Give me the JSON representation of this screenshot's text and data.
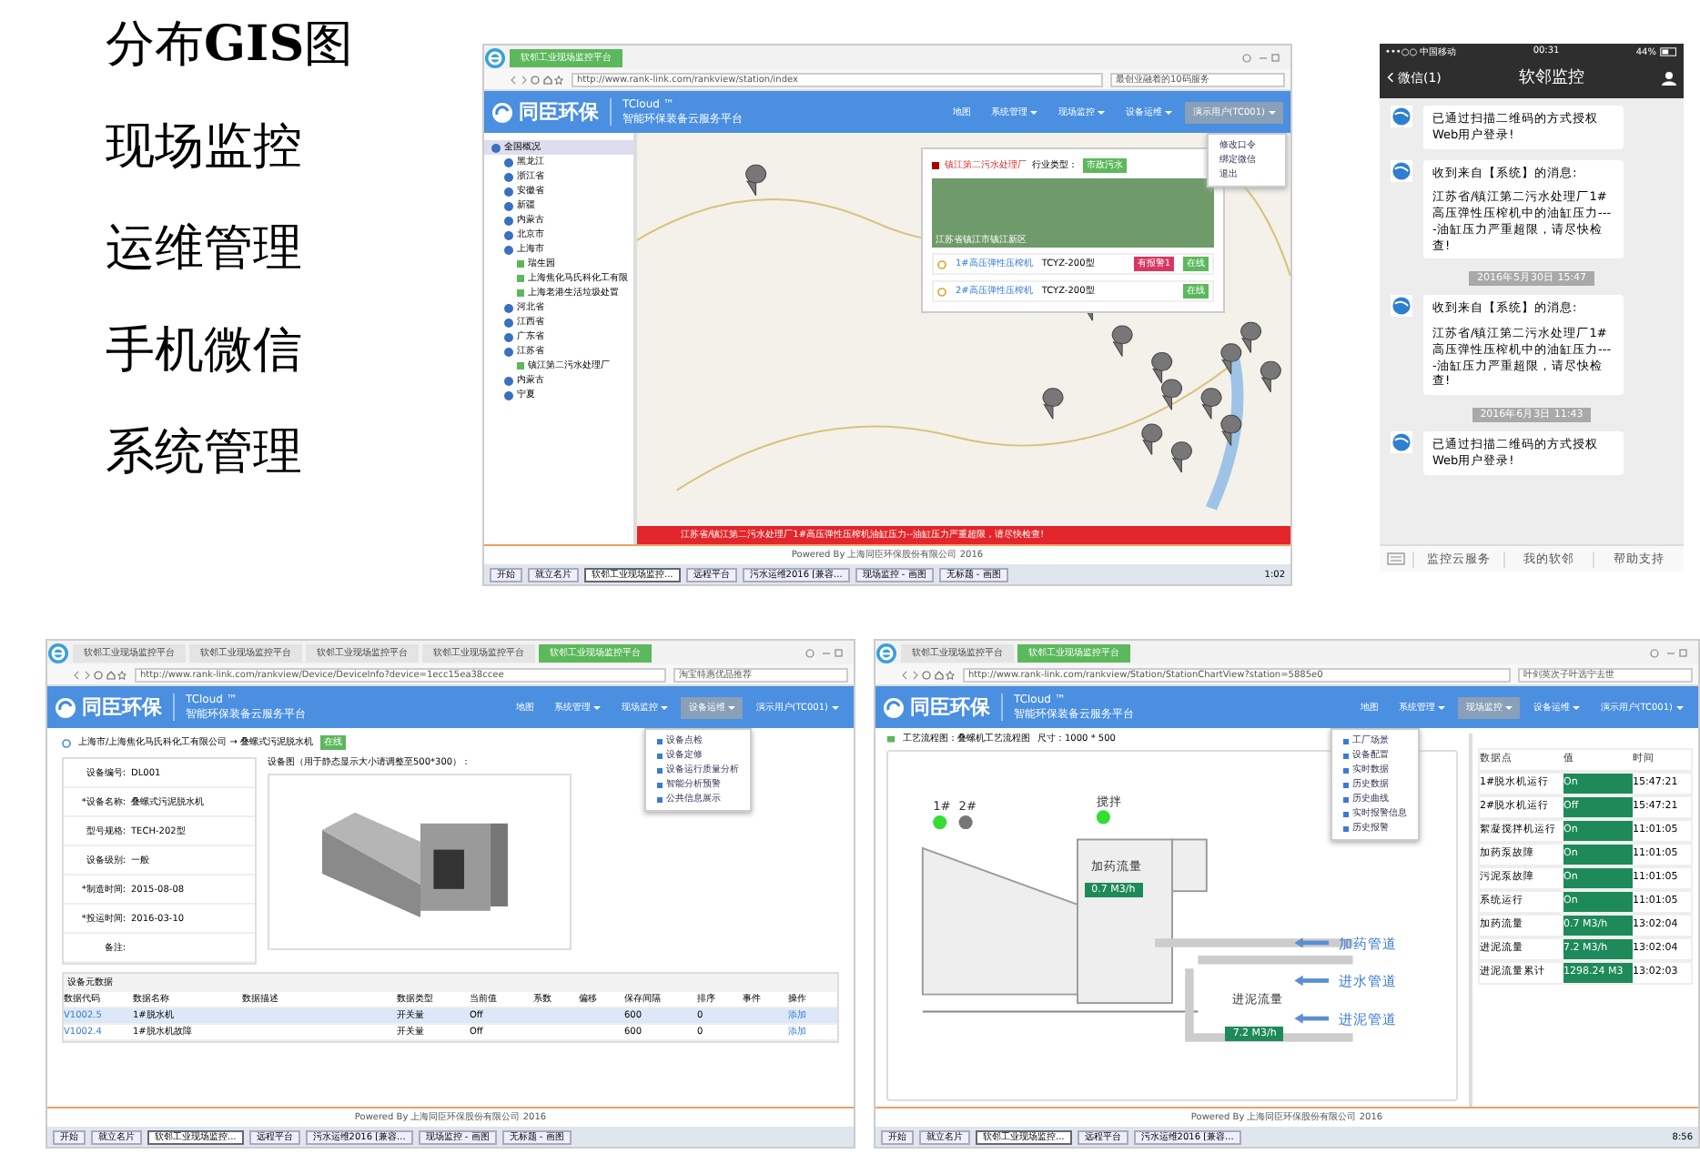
{
  "headings": [
    "分布**GIS**图",
    "现场监控",
    "运维管理",
    "手机微信",
    "系统管理"
  ],
  "gis_window": {
    "tabs": [
      {
        "label": "软邻工业现场监控平台",
        "selected": true
      }
    ],
    "url": "http://www.rank-link.com/rankview/station/index",
    "search": "最创业融着的10码服务",
    "brand": {
      "name": "同臣环保",
      "product": "TCloud ™",
      "subtitle": "智能环保装备云服务平台"
    },
    "nav": [
      {
        "label": "地图",
        "selected": false
      },
      {
        "label": "系统管理",
        "selected": false
      },
      {
        "label": "现场监控",
        "selected": false
      },
      {
        "label": "设备运维",
        "selected": false
      }
    ],
    "user": {
      "label": "演示用户(TC001)",
      "selected": true
    },
    "menu": [
      "修改口令",
      "绑定微信",
      "退出"
    ],
    "tree": [
      {
        "label": "全国概况",
        "selected": true,
        "children": [
          {
            "label": "黑龙江",
            "selected": false
          },
          {
            "label": "浙江省",
            "selected": false
          },
          {
            "label": "安徽省",
            "selected": false
          },
          {
            "label": "新疆",
            "selected": false
          },
          {
            "label": "内蒙古",
            "selected": false
          },
          {
            "label": "北京市",
            "selected": false
          },
          {
            "label": "上海市",
            "selected": false,
            "children": [
              {
                "label": "瑞生园",
                "selected": false
              },
              {
                "label": "上海焦化马氏科化工有限",
                "selected": false
              },
              {
                "label": "上海老港生活垃圾处置",
                "selected": false
              }
            ]
          },
          {
            "label": "河北省",
            "selected": false
          },
          {
            "label": "江西省",
            "selected": false
          },
          {
            "label": "广东省",
            "selected": false
          },
          {
            "label": "江苏省",
            "selected": false,
            "children": [
              {
                "label": "镇江第二污水处理厂",
                "selected": false
              }
            ]
          },
          {
            "label": "内蒙古",
            "selected": false
          },
          {
            "label": "宁夏",
            "selected": false
          }
        ]
      }
    ],
    "popup": {
      "title": "镇江第二污水处理厂",
      "industry_label": "行业类型：",
      "industry": "市政污水",
      "photo_caption": "江苏省镇江市镇江新区",
      "devices": [
        {
          "name": "1#高压弹性压榨机",
          "model": "TCYZ-200型",
          "alarm": "有报警1",
          "status": "在线"
        },
        {
          "name": "2#高压弹性压榨机",
          "model": "TCYZ-200型",
          "status": "在线"
        }
      ]
    },
    "alert": "江苏省/镇江第二污水处理厂1#高压弹性压榨机油缸压力--油缸压力严重超限，请尽快检查!",
    "footer": "Powered By 上海同臣环保股份有限公司 2016",
    "taskbar": [
      {
        "label": "开始",
        "selected": false
      },
      {
        "label": "就立名片",
        "selected": false
      },
      {
        "label": "软邻工业现场监控...",
        "selected": true
      },
      {
        "label": "远程平台",
        "selected": false
      },
      {
        "label": "污水运维2016 [兼容...",
        "selected": false
      },
      {
        "label": "现场监控 - 画图",
        "selected": false
      },
      {
        "label": "无标题 - 画图",
        "selected": false
      }
    ],
    "clock": "1:02"
  },
  "phone": {
    "carrier": "•••○○ 中国移动",
    "time": "00:31",
    "battery": "44%",
    "back": "微信(1)",
    "title": "软邻监控",
    "messages": [
      {
        "kind": "msg",
        "paragraphs": [
          "已通过扫描二维码的方式授权Web用户登录!"
        ]
      },
      {
        "kind": "msg",
        "paragraphs": [
          "收到来自【系统】的消息:",
          "江苏省/镇江第二污水处理厂1#高压弹性压榨机中的油缸压力----油缸压力严重超限，请尽快检查!"
        ]
      },
      {
        "kind": "time",
        "text": "2016年5月30日 15:47"
      },
      {
        "kind": "msg",
        "paragraphs": [
          "收到来自【系统】的消息:",
          "江苏省/镇江第二污水处理厂1#高压弹性压榨机中的油缸压力----油缸压力严重超限，请尽快检查!"
        ]
      },
      {
        "kind": "time",
        "text": "2016年6月3日 11:43"
      },
      {
        "kind": "msg",
        "paragraphs": [
          "已通过扫描二维码的方式授权Web用户登录!"
        ]
      }
    ],
    "menu": [
      "监控云服务",
      "我的软邻",
      "帮助支持"
    ]
  },
  "device_window": {
    "tabs": [
      {
        "label": "软邻工业现场监控平台",
        "selected": false
      },
      {
        "label": "软邻工业现场监控平台",
        "selected": false
      },
      {
        "label": "软邻工业现场监控平台",
        "selected": false
      },
      {
        "label": "软邻工业现场监控平台",
        "selected": false
      },
      {
        "label": "软邻工业现场监控平台",
        "selected": true
      }
    ],
    "url": "http://www.rank-link.com/rankview/Device/DeviceInfo?device=1ecc15ea38ccee",
    "search": "淘宝特惠优品推荐",
    "brand": {
      "name": "同臣环保",
      "product": "TCloud ™",
      "subtitle": "智能环保装备云服务平台"
    },
    "nav": [
      {
        "label": "地图",
        "selected": false
      },
      {
        "label": "系统管理",
        "selected": false
      },
      {
        "label": "现场监控",
        "selected": false
      },
      {
        "label": "设备运维",
        "selected": true
      }
    ],
    "user": {
      "label": "演示用户(TC001)",
      "selected": false
    },
    "menu": [
      "设备点检",
      "设备定修",
      "设备运行质量分析",
      "智能分析预警",
      "公共信息展示"
    ],
    "breadcrumb": "上海市/上海焦化马氏科化工有限公司 → 叠螺式污泥脱水机",
    "status": "在线",
    "fields": [
      {
        "label": "设备编号:",
        "value": "DL001"
      },
      {
        "label": "*设备名称:",
        "value": "叠螺式污泥脱水机"
      },
      {
        "label": "型号规格:",
        "value": "TECH-202型"
      },
      {
        "label": "设备级别:",
        "value": "一般"
      },
      {
        "label": "*制造时间:",
        "value": "2015-08-08"
      },
      {
        "label": "*投运时间:",
        "value": "2016-03-10"
      },
      {
        "label": "备注:"
      }
    ],
    "image_label": "设备图（用于静态显示大小请调整至500*300）：",
    "table": {
      "title": "设备元数据",
      "columns": [
        "数据代码",
        "数据名称",
        "数据描述",
        "数据类型",
        "当前值",
        "系数",
        "偏移",
        "保存间隔",
        "排序",
        "事件",
        "操作"
      ],
      "rows": [
        {
          "selected": true,
          "cells": [
            "V1002.5",
            "1#脱水机",
            "",
            "开关量",
            "Off",
            "",
            "",
            "600",
            "0",
            "",
            "添加"
          ]
        },
        {
          "selected": false,
          "cells": [
            "V1002.4",
            "1#脱水机故障",
            "",
            "开关量",
            "Off",
            "",
            "",
            "600",
            "0",
            "",
            "添加"
          ]
        }
      ]
    },
    "footer": "Powered By 上海同臣环保股份有限公司 2016",
    "taskbar": [
      {
        "label": "开始",
        "selected": false
      },
      {
        "label": "就立名片",
        "selected": false
      },
      {
        "label": "软邻工业现场监控...",
        "selected": true
      },
      {
        "label": "远程平台",
        "selected": false
      },
      {
        "label": "污水运维2016 [兼容...",
        "selected": false
      },
      {
        "label": "现场监控 - 画图",
        "selected": false
      },
      {
        "label": "无标题 - 画图",
        "selected": false
      }
    ]
  },
  "process_window": {
    "tabs": [
      {
        "label": "软邻工业现场监控平台",
        "selected": false
      },
      {
        "label": "软邻工业现场监控平台",
        "selected": true
      }
    ],
    "url": "http://www.rank-link.com/rankview/Station/StationChartView?station=5885e0",
    "search": "叶剑英次子叶选宁去世",
    "brand": {
      "name": "同臣环保",
      "product": "TCloud ™",
      "subtitle": "智能环保装备云服务平台"
    },
    "nav": [
      {
        "label": "地图",
        "selected": false
      },
      {
        "label": "系统管理",
        "selected": false
      },
      {
        "label": "现场监控",
        "selected": true
      },
      {
        "label": "设备运维",
        "selected": false
      }
    ],
    "user": {
      "label": "演示用户(TC001)",
      "selected": false
    },
    "menu": [
      "工厂场景",
      "设备配置",
      "实时数据",
      "历史数据",
      "历史曲线",
      "实时报警信息",
      "历史报警"
    ],
    "breadcrumb": "工艺流程图：叠螺机工艺流程图",
    "size": "尺寸：1000 * 500",
    "indicators": [
      {
        "label": "1#",
        "on": true
      },
      {
        "label": "2#",
        "on": false
      },
      {
        "label": "搅拌",
        "on": true
      }
    ],
    "flows": [
      {
        "label": "加药流量",
        "value": "0.7 M3/h"
      },
      {
        "label": "进泥流量",
        "value": "7.2 M3/h"
      }
    ],
    "pipes": [
      "加药管道",
      "进水管道",
      "进泥管道"
    ],
    "table": {
      "columns": [
        "数据点",
        "值",
        "时间"
      ],
      "rows": [
        [
          "1#脱水机运行",
          "On",
          "15:47:21"
        ],
        [
          "2#脱水机运行",
          "Off",
          "15:47:21"
        ],
        [
          "絮凝搅拌机运行",
          "On",
          "11:01:05"
        ],
        [
          "加药泵故障",
          "On",
          "11:01:05"
        ],
        [
          "污泥泵故障",
          "On",
          "11:01:05"
        ],
        [
          "系统运行",
          "On",
          "11:01:05"
        ],
        [
          "加药流量",
          "0.7 M3/h",
          "13:02:04"
        ],
        [
          "进泥流量",
          "7.2 M3/h",
          "13:02:04"
        ],
        [
          "进泥流量累计",
          "1298.24 M3",
          "13:02:03"
        ]
      ]
    },
    "footer": "Powered By 上海同臣环保股份有限公司 2016",
    "taskbar": [
      {
        "label": "开始",
        "selected": false
      },
      {
        "label": "就立名片",
        "selected": false
      },
      {
        "label": "软邻工业现场监控...",
        "selected": true
      },
      {
        "label": "远程平台",
        "selected": false
      },
      {
        "label": "污水运维2016 [兼容...",
        "selected": false
      }
    ],
    "clock": "8:56"
  }
}
